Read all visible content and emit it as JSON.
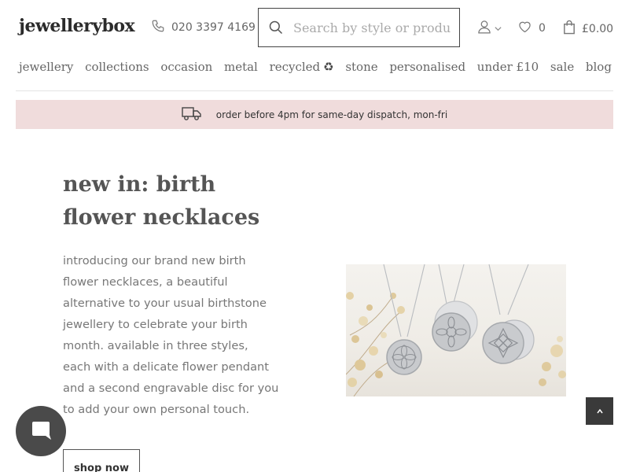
{
  "header": {
    "logo": "jewellerybox",
    "phone": "020 3397 4169",
    "search_placeholder": "Search by style or product",
    "wishlist_count": "0",
    "cart_total": "£0.00"
  },
  "nav": {
    "items": [
      {
        "label": "jewellery"
      },
      {
        "label": "collections"
      },
      {
        "label": "occasion"
      },
      {
        "label": "metal"
      },
      {
        "label": "recycled",
        "icon": "♻"
      },
      {
        "label": "stone"
      },
      {
        "label": "personalised"
      },
      {
        "label": "under £10"
      },
      {
        "label": "sale"
      },
      {
        "label": "blog"
      }
    ]
  },
  "banner": {
    "text": "order before 4pm for same-day dispatch, mon-fri",
    "color": "#f0dcdc"
  },
  "hero": {
    "title": "new in: birth flower necklaces",
    "body": "introducing our brand new birth flower necklaces, a beautiful alternative to your usual birthstone jewellery to celebrate your birth month. available in three styles, each with a delicate flower pendant and a second engravable disc for you to add your own personal touch.",
    "button_label": "shop now"
  }
}
